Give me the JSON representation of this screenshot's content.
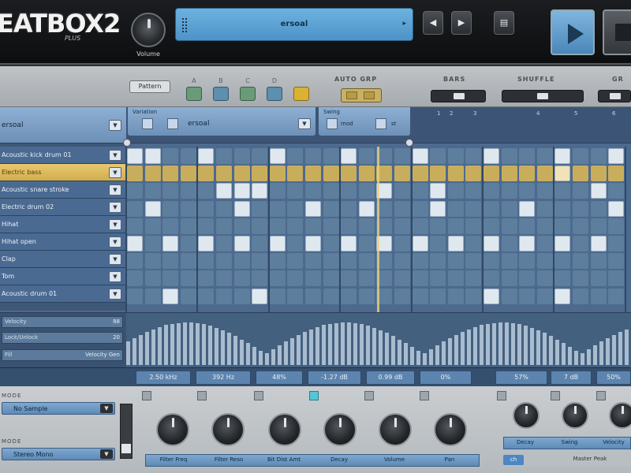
{
  "header": {
    "logo": "EATBOX",
    "logo_number": "2",
    "logo_sub": "PLUS",
    "volume_label": "Volume",
    "preset_name": "ersoal",
    "preset_arrow": "▸",
    "prev_label": "◀",
    "next_label": "▶",
    "save_label": "▤"
  },
  "controls": {
    "pattern_label": "Pattern",
    "step_labels": [
      "A",
      "B",
      "C",
      "D"
    ],
    "auto_grp_label": "AUTO GRP",
    "bars_label": "BARS",
    "shuffle_label": "SHUFFLE",
    "gr_label": "GR"
  },
  "sequencer": {
    "kit_name": "ersoal",
    "variation_label": "Variation",
    "variation_value": "ersoal",
    "swing_label": "Swing",
    "swing_a": "mod",
    "swing_b": "st",
    "ruler": [
      "1",
      "2",
      "3",
      "4",
      "5",
      "6"
    ],
    "tracks": [
      {
        "name": "Acoustic kick drum 01"
      },
      {
        "name": "Electric bass"
      },
      {
        "name": "Acoustic snare stroke"
      },
      {
        "name": "Electric drum 02"
      },
      {
        "name": "Hihat"
      },
      {
        "name": "Hihat open"
      },
      {
        "name": "Clap"
      },
      {
        "name": "Tom"
      },
      {
        "name": "Acoustic drum 01"
      }
    ],
    "selected_track": 1
  },
  "velocity": {
    "row1_label": "Velocity",
    "row1_value": "88",
    "row2_label": "Lock/Unlock",
    "row2_value": "20",
    "row3_label": "Fill",
    "row3_value": "Velocity Gen"
  },
  "fx_strip": [
    "2.50 kHz",
    "392 Hz",
    "48%",
    "-1.27 dB",
    "0.99 dB",
    "0%",
    "57%",
    "7 dB",
    "50%"
  ],
  "bottom": {
    "section1_label": "MODE",
    "section1_value": "No Sample",
    "section2_label": "MODE",
    "section2_value": "Stereo Mono",
    "knob_labels": [
      "Filter Freq",
      "Filter Reso",
      "Bit Dist Amt",
      "Decay",
      "Volume",
      "Pan"
    ],
    "right_labels": [
      "Decay",
      "Swing",
      "Velocity"
    ],
    "channel_badge": "ch",
    "master_label": "Master Peak"
  },
  "colors": {
    "accent_blue": "#4e93c7",
    "selected_track": "#d1ad4c",
    "step_on": "#e0e8ef",
    "active_check": "#55c6d6"
  }
}
